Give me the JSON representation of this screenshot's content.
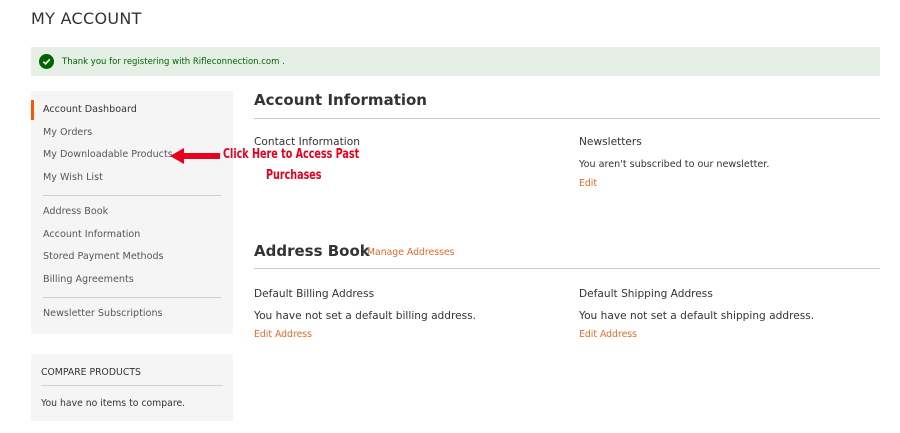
{
  "page": {
    "title": "MY ACCOUNT"
  },
  "notice": {
    "message": "Thank you for registering with Rifleconnection.com ."
  },
  "sidebar": {
    "items": [
      {
        "label": "Account Dashboard"
      },
      {
        "label": "My Orders"
      },
      {
        "label": "My Downloadable Products"
      },
      {
        "label": "My Wish List"
      },
      {
        "label": "Address Book"
      },
      {
        "label": "Account Information"
      },
      {
        "label": "Stored Payment Methods"
      },
      {
        "label": "Billing Agreements"
      },
      {
        "label": "Newsletter Subscriptions"
      }
    ]
  },
  "compare": {
    "title": "COMPARE PRODUCTS",
    "empty_text": "You have no items to compare."
  },
  "account_info": {
    "heading": "Account Information",
    "contact_title": "Contact Information",
    "newsletters_title": "Newsletters",
    "newsletters_text": "You aren't subscribed to our newsletter.",
    "newsletters_edit": "Edit"
  },
  "address_book": {
    "heading": "Address Book",
    "manage_link": "Manage Addresses",
    "billing_title": "Default Billing Address",
    "billing_text": "You have not set a default billing address.",
    "billing_edit": "Edit Address",
    "shipping_title": "Default Shipping Address",
    "shipping_text": "You have not set a default shipping address.",
    "shipping_edit": "Edit Address"
  },
  "annotation": {
    "line1": "Click Here to Access Past",
    "line2": "Purchases",
    "color": "#e8001c"
  },
  "colors": {
    "accent": "#ff5501",
    "link": "#e06a2c",
    "success": "#006400"
  }
}
